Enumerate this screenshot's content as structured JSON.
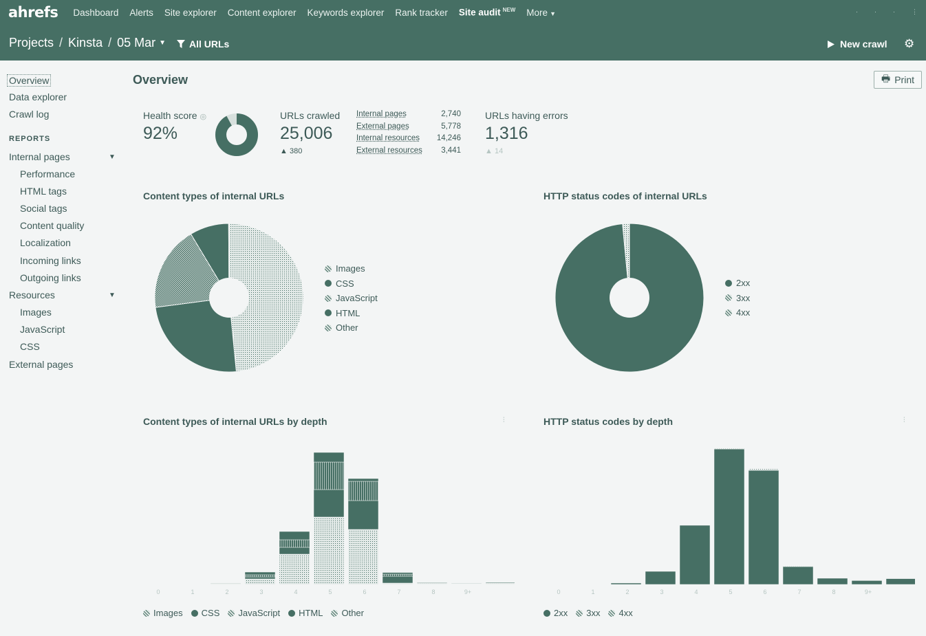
{
  "nav": {
    "logo": "ahrefs",
    "items": [
      "Dashboard",
      "Alerts",
      "Site explorer",
      "Content explorer",
      "Keywords explorer",
      "Rank tracker"
    ],
    "site_audit": "Site audit",
    "site_audit_badge": "NEW",
    "more": "More"
  },
  "subbar": {
    "projects": "Projects",
    "project": "Kinsta",
    "crawl_date": "05 Mar",
    "filter": "All URLs",
    "new_crawl": "New crawl"
  },
  "sidebar": {
    "overview": "Overview",
    "data_explorer": "Data explorer",
    "crawl_log": "Crawl log",
    "reports_heading": "REPORTS",
    "internal_pages": "Internal pages",
    "internal_children": [
      "Performance",
      "HTML tags",
      "Social tags",
      "Content quality",
      "Localization",
      "Incoming links",
      "Outgoing links"
    ],
    "resources": "Resources",
    "resource_children": [
      "Images",
      "JavaScript",
      "CSS"
    ],
    "external_pages": "External pages"
  },
  "main": {
    "title": "Overview",
    "print": "Print",
    "health_label": "Health score",
    "health_value": "92%",
    "health_fraction": 0.92,
    "crawled_label": "URLs crawled",
    "crawled_value": "25,006",
    "crawled_delta": "380",
    "breakdown": [
      {
        "label": "Internal pages",
        "value": "2,740"
      },
      {
        "label": "External pages",
        "value": "5,778"
      },
      {
        "label": "Internal resources",
        "value": "14,246"
      },
      {
        "label": "External resources",
        "value": "3,441"
      }
    ],
    "errors_label": "URLs having errors",
    "errors_value": "1,316",
    "errors_delta": "14"
  },
  "sections": {
    "content_types": "Content types of internal URLs",
    "http_status": "HTTP status codes of internal URLs",
    "content_depth": "Content types of internal URLs by depth",
    "status_depth": "HTTP status codes by depth"
  },
  "legends": {
    "content": [
      "Images",
      "CSS",
      "JavaScript",
      "HTML",
      "Other"
    ],
    "status": [
      "2xx",
      "3xx",
      "4xx"
    ]
  },
  "colors": {
    "brand": "#466f64",
    "background": "#f3f5f5",
    "text": "#3d5a57"
  },
  "chart_data": [
    {
      "type": "pie",
      "title": "Content types of internal URLs",
      "categories": [
        "Images",
        "CSS",
        "JavaScript",
        "HTML",
        "Other"
      ],
      "values": [
        48.5,
        24.5,
        18.5,
        8.5,
        0.1
      ]
    },
    {
      "type": "pie",
      "title": "HTTP status codes of internal URLs",
      "categories": [
        "2xx",
        "3xx",
        "4xx"
      ],
      "values": [
        98.5,
        1.4,
        0.1
      ]
    },
    {
      "type": "bar",
      "title": "Content types of internal URLs by depth",
      "categories": [
        "0",
        "1",
        "2",
        "3",
        "4",
        "5",
        "6",
        "7",
        "8",
        "9+"
      ],
      "series": [
        {
          "name": "Images",
          "values": [
            0,
            4,
            40,
            220,
            490,
            400,
            10,
            5,
            3,
            4
          ]
        },
        {
          "name": "CSS",
          "values": [
            0,
            2,
            15,
            50,
            200,
            210,
            50,
            3,
            2,
            3
          ]
        },
        {
          "name": "JavaScript",
          "values": [
            0,
            1,
            15,
            55,
            200,
            140,
            15,
            3,
            2,
            3
          ]
        },
        {
          "name": "HTML",
          "values": [
            0,
            3,
            20,
            60,
            70,
            20,
            12,
            4,
            3,
            5
          ]
        },
        {
          "name": "Other",
          "values": [
            0,
            0,
            0,
            0,
            0,
            0,
            0,
            0,
            0,
            0
          ]
        }
      ],
      "stack_order": [
        "Images",
        "CSS",
        "JavaScript",
        "HTML",
        "Other"
      ],
      "ylim": [
        0,
        1000
      ]
    },
    {
      "type": "bar",
      "title": "HTTP status codes by depth",
      "categories": [
        "0",
        "1",
        "2",
        "3",
        "4",
        "5",
        "6",
        "7",
        "8",
        "9+"
      ],
      "series": [
        {
          "name": "2xx",
          "values": [
            0,
            10,
            95,
            430,
            985,
            830,
            130,
            45,
            28,
            42
          ]
        },
        {
          "name": "3xx",
          "values": [
            0,
            0,
            0,
            0,
            4,
            10,
            3,
            0,
            0,
            0
          ]
        },
        {
          "name": "4xx",
          "values": [
            0,
            0,
            0,
            0,
            0,
            0,
            0,
            0,
            0,
            0
          ]
        }
      ],
      "ylim": [
        0,
        1000
      ]
    }
  ]
}
